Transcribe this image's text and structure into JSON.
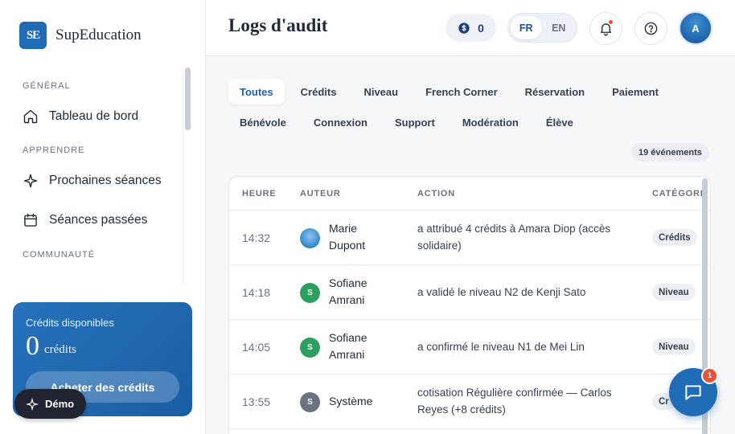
{
  "brand": {
    "name": "SupEducation",
    "logo_text": "SE"
  },
  "sidebar": {
    "sections": [
      {
        "title": "GÉNÉRAL",
        "items": [
          {
            "label": "Tableau de bord",
            "icon": "home-icon"
          }
        ]
      },
      {
        "title": "APPRENDRE",
        "items": [
          {
            "label": "Prochaines séances",
            "icon": "sparkle-icon"
          },
          {
            "label": "Séances passées",
            "icon": "calendar-icon"
          }
        ]
      },
      {
        "title": "COMMUNAUTÉ",
        "items": []
      }
    ],
    "credits": {
      "label": "Crédits disponibles",
      "value": "0",
      "unit": "crédits",
      "button": "Acheter des crédits"
    },
    "demo_label": "Démo"
  },
  "header": {
    "title": "Logs d'audit",
    "coin_count": "0",
    "languages": [
      "FR",
      "EN"
    ],
    "active_language": "FR",
    "avatar_initial": "A"
  },
  "filters": {
    "row1": [
      "Toutes",
      "Crédits",
      "Niveau",
      "French Corner",
      "Réservation",
      "Paiement"
    ],
    "row2": [
      "Bénévole",
      "Connexion",
      "Support",
      "Modération",
      "Élève"
    ],
    "active": "Toutes",
    "count_label": "19 événements"
  },
  "table": {
    "columns": [
      "HEURE",
      "AUTEUR",
      "ACTION",
      "CATÉGORI"
    ],
    "rows": [
      {
        "time": "14:32",
        "author": "Marie Dupont",
        "avatar": "",
        "avatar_color": "#3b8fd6",
        "action": "a attribué 4 crédits à Amara Diop (accès solidaire)",
        "category": "Crédits"
      },
      {
        "time": "14:18",
        "author": "Sofiane Amrani",
        "avatar": "S",
        "avatar_color": "#2e9e5f",
        "action": "a validé le niveau N2 de Kenji Sato",
        "category": "Niveau"
      },
      {
        "time": "14:05",
        "author": "Sofiane Amrani",
        "avatar": "S",
        "avatar_color": "#2e9e5f",
        "action": "a confirmé le niveau N1 de Mei Lin",
        "category": "Niveau"
      },
      {
        "time": "13:55",
        "author": "Système",
        "avatar": "S",
        "avatar_color": "#6b7280",
        "action": "cotisation Régulière confirmée — Carlos Reyes (+8 crédits)",
        "category": "Cr"
      }
    ]
  },
  "chat": {
    "badge": "1"
  },
  "colors": {
    "accent": "#1f6bb5",
    "danger": "#e5533d"
  }
}
